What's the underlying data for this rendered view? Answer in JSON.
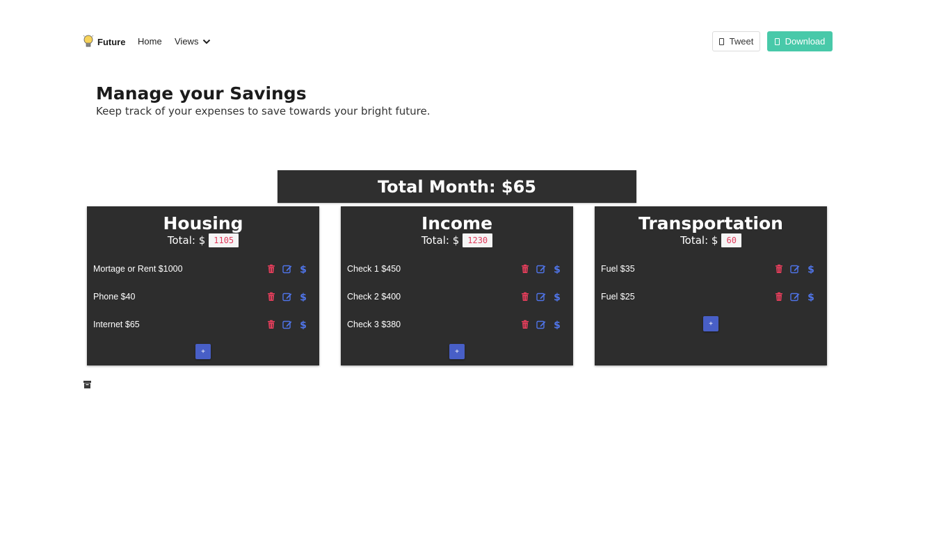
{
  "nav": {
    "brand": "Future",
    "home": "Home",
    "views": "Views",
    "tweet": "Tweet",
    "download": "Download"
  },
  "hero": {
    "title": "Manage your Savings",
    "subtitle": "Keep track of your expenses to save towards your bright future."
  },
  "total_month": "Total Month: $65",
  "total_prefix": "Total: $",
  "cards": [
    {
      "title": "Housing",
      "total": "1105",
      "items": [
        "Mortage or Rent $1000",
        "Phone $40",
        "Internet $65"
      ],
      "add_label": "+"
    },
    {
      "title": "Income",
      "total": "1230",
      "items": [
        "Check 1 $450",
        "Check 2 $400",
        "Check 3 $380"
      ],
      "add_label": "+"
    },
    {
      "title": "Transportation",
      "total": "60",
      "items": [
        "Fuel $35",
        "Fuel $25"
      ],
      "add_label": "+"
    }
  ],
  "colors": {
    "card_bg": "#2d2d2d",
    "download_bg": "#48c9a9",
    "delete_icon": "#e83e5c",
    "action_icon": "#4f74e8",
    "add_button": "#485fc7",
    "total_code": "#e0395a"
  },
  "icons": {
    "delete": "trash-icon",
    "edit": "edit-icon",
    "money": "dollar-icon",
    "archive": "archive-icon"
  }
}
